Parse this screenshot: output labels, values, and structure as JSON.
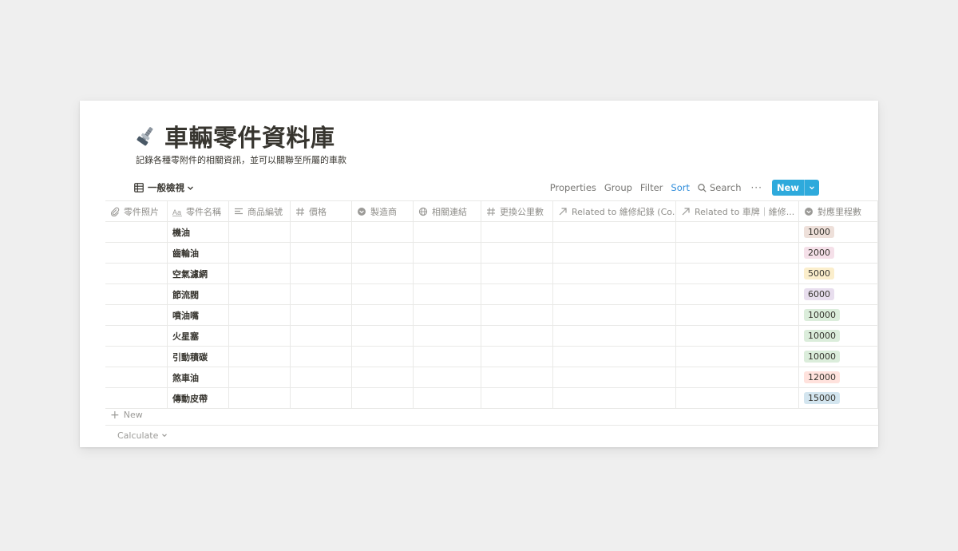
{
  "page": {
    "icon": "nut-and-bolt-icon",
    "title": "車輛零件資料庫",
    "description": "記錄各種零附件的相關資訊，並可以關聯至所屬的車款"
  },
  "toolbar": {
    "view_name": "一般檢視",
    "view_icon": "table-icon",
    "properties_label": "Properties",
    "group_label": "Group",
    "filter_label": "Filter",
    "sort_label": "Sort",
    "search_label": "Search",
    "more_label": "···",
    "new_label": "New",
    "accent_color": "#2eaadc",
    "sort_active_color": "#2f8ddb"
  },
  "table": {
    "columns": [
      {
        "label": "零件照片",
        "icon": "paperclip-icon"
      },
      {
        "label": "零件名稱",
        "icon": "title-aa-icon"
      },
      {
        "label": "商品編號",
        "icon": "text-lines-icon"
      },
      {
        "label": "價格",
        "icon": "hash-icon"
      },
      {
        "label": "製造商",
        "icon": "select-icon"
      },
      {
        "label": "相關連結",
        "icon": "link-icon"
      },
      {
        "label": "更換公里數",
        "icon": "hash-icon"
      },
      {
        "label": "Related to 維修紀錄 (Co...",
        "icon": "relation-arrow-icon"
      },
      {
        "label": "Related to 車牌｜維修...",
        "icon": "relation-arrow-icon"
      },
      {
        "label": "對應里程數",
        "icon": "select-icon"
      }
    ],
    "rows": [
      {
        "name": "機油",
        "mileage": "1000",
        "mileage_color": "#eee0da"
      },
      {
        "name": "齒輪油",
        "mileage": "2000",
        "mileage_color": "#f5e0e9"
      },
      {
        "name": "空氣濾網",
        "mileage": "5000",
        "mileage_color": "#fbeecc"
      },
      {
        "name": "節流閥",
        "mileage": "6000",
        "mileage_color": "#e8deee"
      },
      {
        "name": "噴油嘴",
        "mileage": "10000",
        "mileage_color": "#dbeddb"
      },
      {
        "name": "火星塞",
        "mileage": "10000",
        "mileage_color": "#dbeddb"
      },
      {
        "name": "引動積碳",
        "mileage": "10000",
        "mileage_color": "#dbeddb"
      },
      {
        "name": "煞車油",
        "mileage": "12000",
        "mileage_color": "#ffe2dd"
      },
      {
        "name": "傳動皮帶",
        "mileage": "15000",
        "mileage_color": "#d3e5ef"
      }
    ],
    "add_row_label": "New",
    "calculate_label": "Calculate"
  }
}
